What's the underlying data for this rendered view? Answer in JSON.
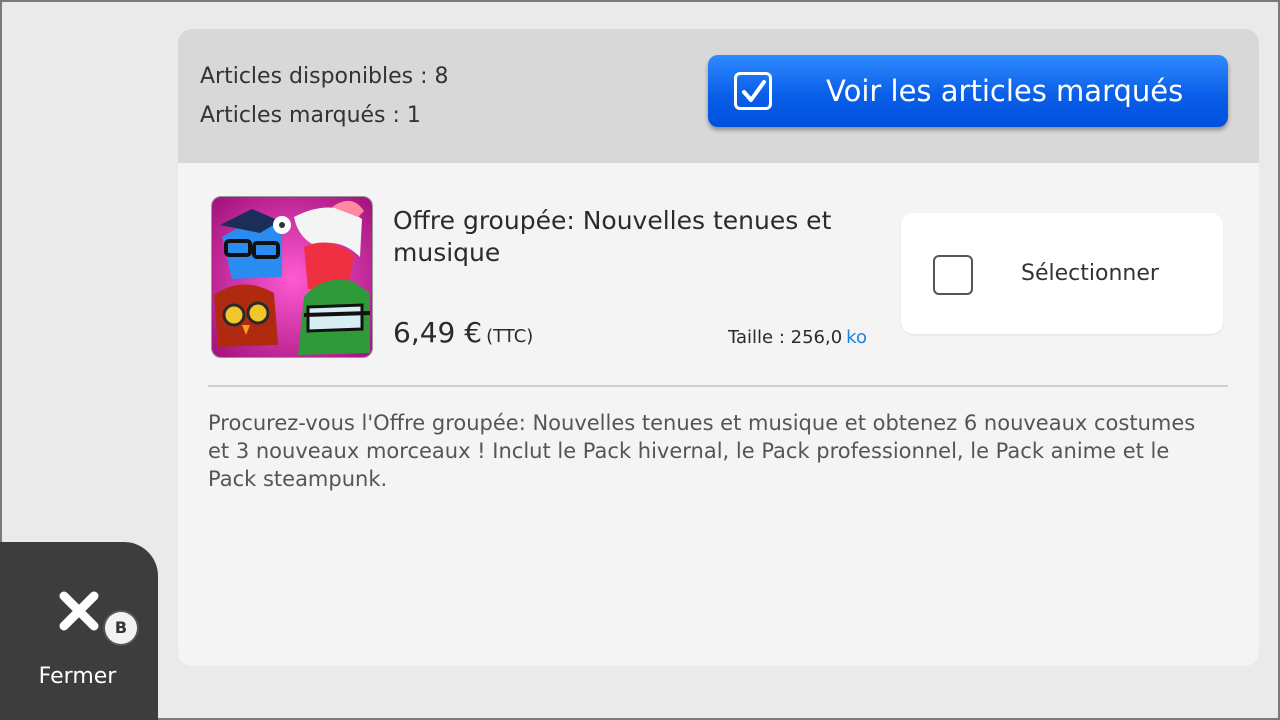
{
  "header": {
    "available_label": "Articles disponibles : 8",
    "marked_label": "Articles marqués : 1",
    "view_marked_button": "Voir les articles marqués"
  },
  "item": {
    "title": "Offre groupée: Nouvelles tenues et musique",
    "price": "6,49 €",
    "price_suffix": "(TTC)",
    "size_label": "Taille : 256,0",
    "size_unit": "ko",
    "select_label": "Sélectionner",
    "selected": false,
    "description": "Procurez-vous l'Offre groupée: Nouvelles tenues et musique et obtenez 6 nouveaux costumes et 3 nouveaux morceaux ! Inclut le Pack hivernal, le Pack professionnel, le Pack anime et le Pack steampunk."
  },
  "footer": {
    "close_label": "Fermer",
    "close_button_hint": "B"
  },
  "colors": {
    "accent_blue": "#0a5fe8",
    "size_unit": "#1d82e0",
    "thumb_background": "#d0209a"
  },
  "icons": [
    "checkbox-checked-icon",
    "checkbox-empty-icon",
    "close-x-icon",
    "b-button-icon",
    "bundle-thumbnail"
  ]
}
